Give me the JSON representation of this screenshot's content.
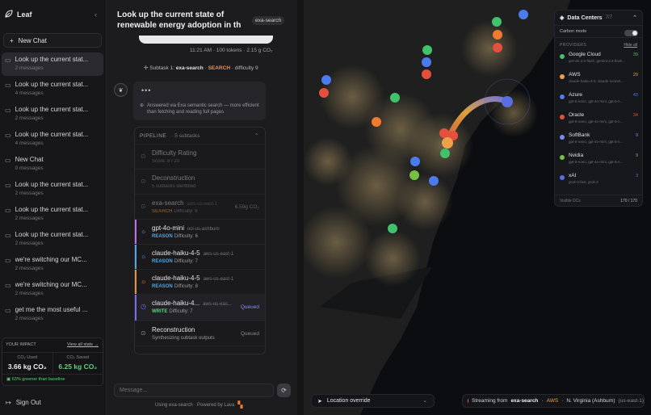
{
  "app": {
    "name": "Leaf"
  },
  "sidebar": {
    "new_chat_label": "New Chat",
    "chats": [
      {
        "title": "Look up the current stat...",
        "sub": "2 messages",
        "active": true
      },
      {
        "title": "Look up the current stat...",
        "sub": "4 messages"
      },
      {
        "title": "Look up the current stat...",
        "sub": "2 messages"
      },
      {
        "title": "Look up the current stat...",
        "sub": "4 messages"
      },
      {
        "title": "New Chat",
        "sub": "0 messages"
      },
      {
        "title": "Look up the current stat...",
        "sub": "2 messages"
      },
      {
        "title": "Look up the current stat...",
        "sub": "2 messages"
      },
      {
        "title": "Look up the current stat...",
        "sub": "2 messages"
      },
      {
        "title": "we're switching our MC...",
        "sub": "2 messages"
      },
      {
        "title": "we're switching our MC...",
        "sub": "2 messages"
      },
      {
        "title": "get me the most useful ...",
        "sub": "2 messages"
      }
    ],
    "impact": {
      "title": "YOUR IMPACT",
      "view_all": "View all stats →",
      "used_label": "CO₂ Used",
      "used_value": "3.66 kg CO₂",
      "saved_label": "CO₂ Saved",
      "saved_value": "6.25 kg CO₂",
      "footnote": "63% greener than baseline"
    },
    "sign_out": "Sign Out"
  },
  "chat": {
    "title": "Look up the current state of renewable energy adoption in th",
    "badge": "exa-search",
    "msg_meta": "11:21 AM · 100 tokens · 2.15 g CO₂",
    "subtask": {
      "prefix": "Subtask 1:",
      "tool": "exa-search",
      "kind": "SEARCH",
      "difficulty": "difficulty 9"
    },
    "answer": {
      "dots": "•••",
      "text": "Answered via Exa semantic search — more efficient than fetching and reading full pages"
    },
    "pipeline": {
      "title": "PIPELINE",
      "count": "5 subtasks",
      "rows": [
        {
          "name": "Difficulty Rating",
          "server": "",
          "sub": "Score: 8 / 20",
          "kind": "",
          "right": "",
          "state": "dim",
          "color": "#888888"
        },
        {
          "name": "Deconstruction",
          "server": "",
          "sub": "5 subtasks identified",
          "kind": "",
          "right": "",
          "state": "dim",
          "color": "#888888"
        },
        {
          "name": "exa-search",
          "server": "aws-us-east-1",
          "sub": "Difficulty: 9",
          "kind": "SEARCH",
          "right": "6.59g CO₂",
          "state": "dim",
          "color": "#888888"
        },
        {
          "name": "gpt-4o-mini",
          "server": "oci-us-ashburn",
          "sub": "Difficulty: 6",
          "kind": "REASON",
          "right": "",
          "state": "bar",
          "color": "#c26df0"
        },
        {
          "name": "claude-haiku-4-5",
          "server": "aws-us-east-1",
          "sub": "Difficulty: 7",
          "kind": "REASON",
          "right": "",
          "state": "bar",
          "color": "#4fa7e6"
        },
        {
          "name": "claude-haiku-4-5",
          "server": "aws-us-east-1",
          "sub": "Difficulty: 8",
          "kind": "REASON",
          "right": "",
          "state": "bar",
          "color": "#e8923c"
        },
        {
          "name": "claude-haiku-4...",
          "server": "aws-us-eas...",
          "sub": "Difficulty: 7",
          "kind": "WRITE",
          "right": "Queued",
          "state": "active",
          "color": "#7a6cf0"
        },
        {
          "name": "Reconstruction",
          "server": "",
          "sub": "Synthesizing subtask outputs",
          "kind": "",
          "right": "Queued",
          "state": "normal",
          "color": "#888888"
        }
      ]
    },
    "composer_placeholder": "Message...",
    "powered_by": "Using exa-search · Powered by Lava"
  },
  "map": {
    "data_centers": {
      "title": "Data Centers",
      "count": "7/7",
      "carbon_mode": "Carbon mode",
      "providers_label": "PROVIDERS",
      "hide_all": "Hide all",
      "providers": [
        {
          "name": "Google Cloud",
          "models": "gemini-2.0-flash, gemini-2.5-flash...",
          "count": "39",
          "color": "#3fc26a"
        },
        {
          "name": "AWS",
          "models": "claude-haiku-4-5, claude-sonnet...",
          "count": "29",
          "color": "#f0a04a"
        },
        {
          "name": "Azure",
          "models": "gpt-5-nano, gpt-4o-mini, gpt-5-n...",
          "count": "43",
          "color": "#4a7cf0"
        },
        {
          "name": "Oracle",
          "models": "gpt-5-nano, gpt-4o-mini, gpt-5-n...",
          "count": "34",
          "color": "#e5503c"
        },
        {
          "name": "SoftBank",
          "models": "gpt-5-nano, gpt-4o-mini, gpt-5-n...",
          "count": "9",
          "color": "#7a8cf0"
        },
        {
          "name": "Nvidia",
          "models": "gpt-5-nano, gpt-4o-mini, gpt-5-n...",
          "count": "9",
          "color": "#76c043"
        },
        {
          "name": "xAI",
          "models": "grok-3-fast, grok-3",
          "count": "3",
          "color": "#5b6ee0"
        }
      ],
      "visible_label": "Visible DCs",
      "visible_value": "170 / 170"
    },
    "location_override": "Location override",
    "stream": {
      "prefix": "Streaming from",
      "tool": "exa-search",
      "provider": "AWS",
      "location": "N. Virginia (Ashburn)",
      "region": "(us-east-1)"
    }
  }
}
